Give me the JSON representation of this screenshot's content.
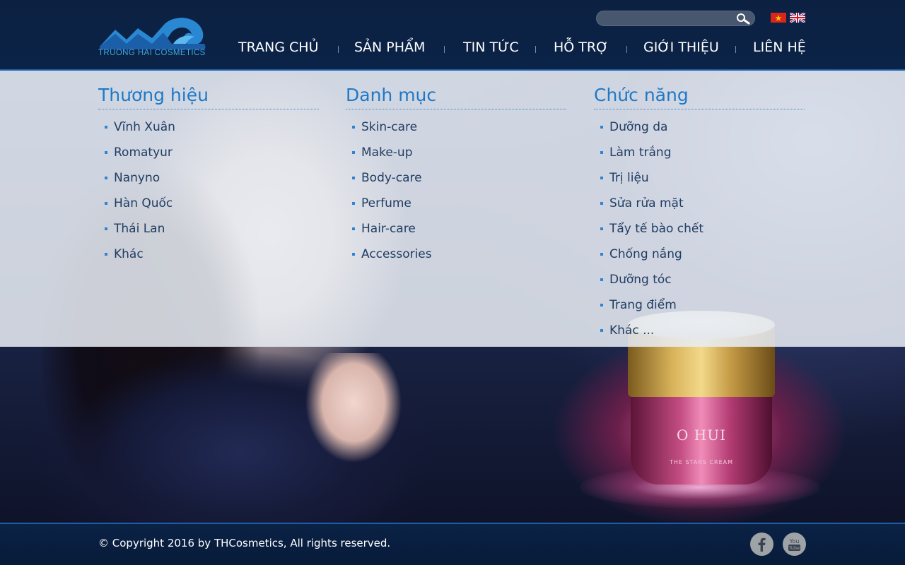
{
  "header": {
    "logo_text": "TRUONG HAI COSMETICS",
    "search": {
      "placeholder": "",
      "value": ""
    },
    "languages": [
      {
        "code": "vi",
        "icon": "vietnam-flag-icon"
      },
      {
        "code": "en",
        "icon": "uk-flag-icon"
      }
    ],
    "nav": [
      {
        "label": "TRANG CHỦ"
      },
      {
        "label": "SẢN PHẨM"
      },
      {
        "label": "TIN TỨC"
      },
      {
        "label": "HỖ TRỢ"
      },
      {
        "label": "GIỚI THIỆU"
      },
      {
        "label": "LIÊN HỆ"
      }
    ]
  },
  "mega_menu": {
    "columns": [
      {
        "title": "Thương hiệu",
        "items": [
          "Vĩnh Xuân",
          "Romatyur",
          "Nanyno",
          "Hàn Quốc",
          "Thái Lan",
          "Khác"
        ]
      },
      {
        "title": "Danh mục",
        "items": [
          "Skin-care",
          "Make-up",
          "Body-care",
          "Perfume",
          "Hair-care",
          "Accessories"
        ]
      },
      {
        "title": "Chức năng",
        "items": [
          "Dưỡng da",
          "Làm trắng",
          "Trị liệu",
          "Sửa rửa mặt",
          "Tẩy tế bào chết",
          "Chống nắng",
          "Dưỡng tóc",
          "Trang điểm",
          "Khác ..."
        ]
      }
    ]
  },
  "hero": {
    "product_brand": "O HUI",
    "product_name": "THE STARS CREAM"
  },
  "footer": {
    "copyright": "© Copyright 2016 by THCosmetics, All rights reserved.",
    "social": [
      {
        "icon": "facebook-icon"
      },
      {
        "icon": "youtube-icon"
      }
    ]
  },
  "colors": {
    "header_bg": "#0c2142",
    "accent": "#1f79c7",
    "menu_text": "#203d63",
    "divider": "#1d5ea8"
  }
}
